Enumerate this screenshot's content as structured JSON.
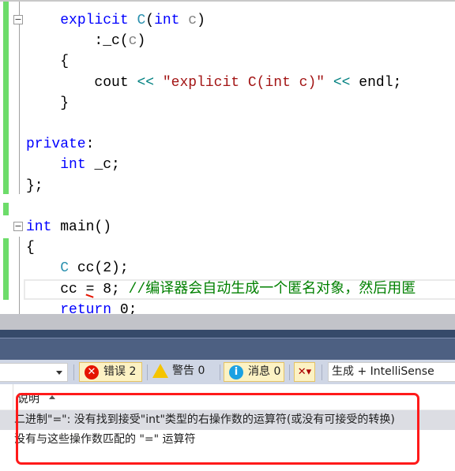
{
  "editor": {
    "lines": [
      {
        "indent": "    ",
        "parts": [
          [
            "kw",
            "explicit "
          ],
          [
            "ty",
            "C"
          ],
          [
            "",
            "("
          ],
          [
            "kw",
            "int "
          ],
          [
            "pa",
            "c"
          ],
          [
            "",
            ")"
          ]
        ]
      },
      {
        "indent": "        ",
        "parts": [
          [
            "",
            ":_c("
          ],
          [
            "pa",
            "c"
          ],
          [
            "",
            ")"
          ]
        ]
      },
      {
        "indent": "    ",
        "parts": [
          [
            "",
            "{"
          ]
        ]
      },
      {
        "indent": "        ",
        "parts": [
          [
            "",
            "cout "
          ],
          [
            "op",
            "<< "
          ],
          [
            "st",
            "\"explicit C(int c)\""
          ],
          [
            "op",
            " <<"
          ],
          [
            "",
            " endl;"
          ]
        ]
      },
      {
        "indent": "    ",
        "parts": [
          [
            "",
            "}"
          ]
        ]
      },
      {
        "indent": "",
        "parts": []
      },
      {
        "indent": "",
        "parts": [
          [
            "kw",
            "private"
          ],
          [
            "",
            ":"
          ]
        ]
      },
      {
        "indent": "    ",
        "parts": [
          [
            "kw",
            "int "
          ],
          [
            "",
            "_c;"
          ]
        ]
      },
      {
        "indent": "",
        "parts": [
          [
            "",
            "};"
          ]
        ]
      },
      {
        "indent": "",
        "parts": []
      },
      {
        "indent": "",
        "parts": [
          [
            "kw",
            "int "
          ],
          [
            "",
            "main()"
          ]
        ]
      },
      {
        "indent": "",
        "parts": [
          [
            "",
            "{"
          ]
        ]
      },
      {
        "indent": "    ",
        "parts": [
          [
            "ty",
            "C "
          ],
          [
            "",
            "cc(2);"
          ]
        ]
      },
      {
        "indent": "    ",
        "parts": [
          [
            "",
            "cc = 8; "
          ],
          [
            "cm",
            "//编译器会自动生成一个匿名对象，然后用匿"
          ]
        ]
      },
      {
        "indent": "    ",
        "parts": [
          [
            "kw",
            "return "
          ],
          [
            "",
            "0;"
          ]
        ]
      }
    ]
  },
  "error_list": {
    "errors_label": "错误 2",
    "warnings_label": "警告 0",
    "messages_label": "消息 0",
    "scope": "生成 + IntelliSense",
    "column_header": "说明",
    "rows": [
      "二进制\"=\": 没有找到接受\"int\"类型的右操作数的运算符(或没有可接受的转换)",
      "没有与这些操作数匹配的 \"=\" 运算符"
    ]
  },
  "colors": {
    "error": "#e51400",
    "warning": "#f5c400",
    "info": "#1ba1e2",
    "highlight": "#ff1a1a"
  }
}
